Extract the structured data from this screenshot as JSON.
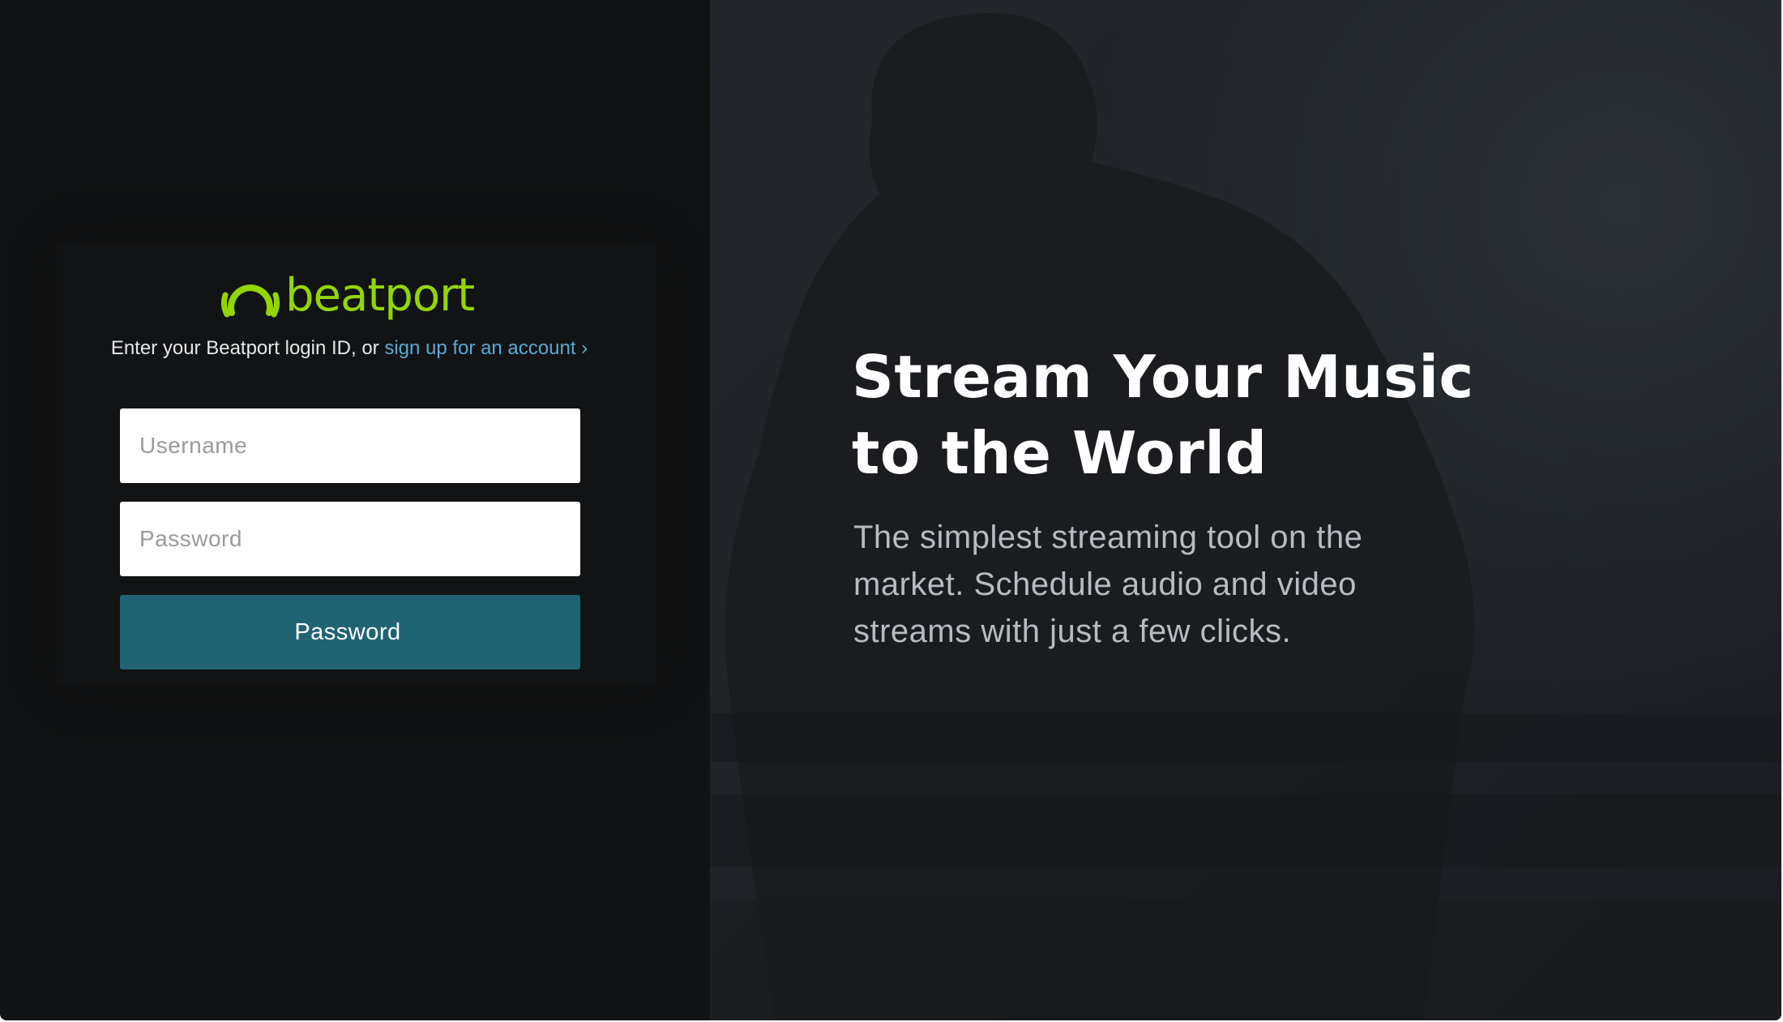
{
  "login": {
    "logo_text": "beatport",
    "prompt_text": "Enter your Beatport login ID, or ",
    "signup_link": "sign up for an account ›",
    "username_placeholder": "Username",
    "password_placeholder": "Password",
    "submit_label": "Password"
  },
  "hero": {
    "title_line1": "Stream Your Music",
    "title_line2": "to the World",
    "subtitle": "The simplest streaming tool on the market. Schedule audio and video streams with just a few clicks."
  },
  "colors": {
    "brand_green": "#94d500",
    "link_blue": "#5aa9d6",
    "button_teal": "#206473",
    "login_bg": "#111213",
    "hero_bg": "#1c1f23"
  },
  "icons": {
    "logo_mark": "headphones-icon"
  }
}
